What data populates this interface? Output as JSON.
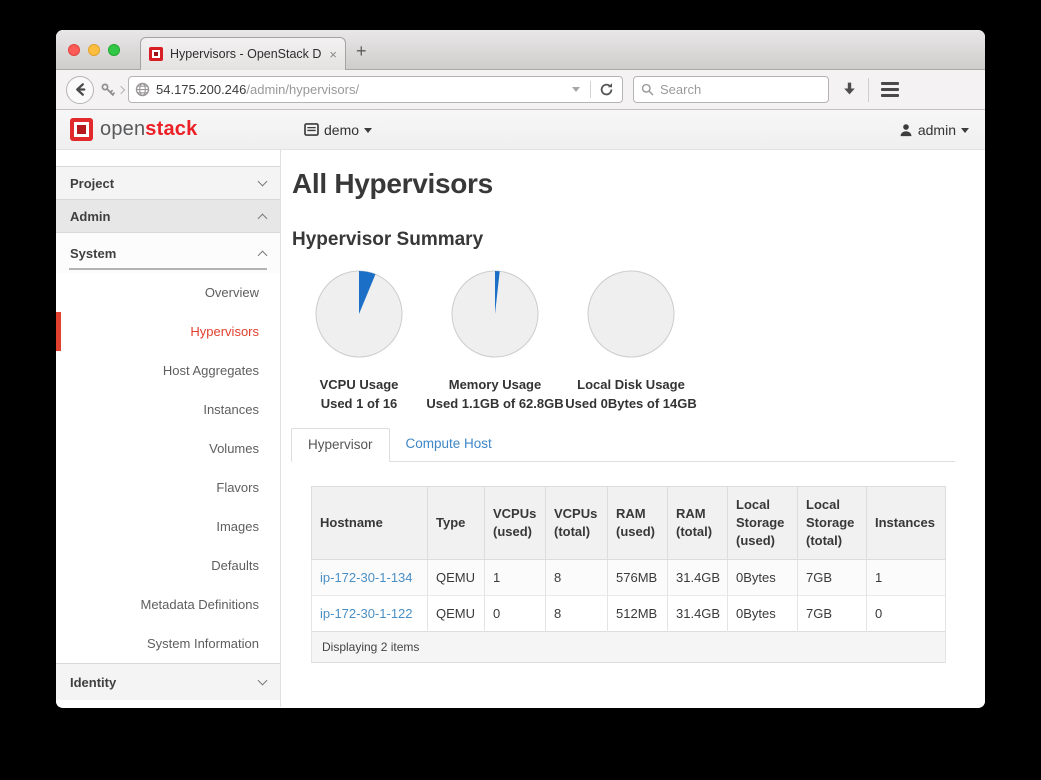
{
  "colors": {
    "accent": "#e0402e",
    "link": "#4a8fc4",
    "pie_used": "#1c6fc7",
    "pie_free": "#efefef",
    "logo_red": "#ed1f26"
  },
  "browser": {
    "tab_title": "Hypervisors - OpenStack D...",
    "close_tab": "×",
    "new_tab": "+",
    "url_host": "54.175.200.246",
    "url_path": "/admin/hypervisors/",
    "search_placeholder": "Search"
  },
  "header": {
    "brand_open": "open",
    "brand_stack": "stack",
    "project": "demo",
    "user": "admin"
  },
  "sidebar": {
    "project_label": "Project",
    "admin_label": "Admin",
    "system_label": "System",
    "identity_label": "Identity",
    "system_items": [
      {
        "label": "Overview",
        "active": false
      },
      {
        "label": "Hypervisors",
        "active": true
      },
      {
        "label": "Host Aggregates",
        "active": false
      },
      {
        "label": "Instances",
        "active": false
      },
      {
        "label": "Volumes",
        "active": false
      },
      {
        "label": "Flavors",
        "active": false
      },
      {
        "label": "Images",
        "active": false
      },
      {
        "label": "Defaults",
        "active": false
      },
      {
        "label": "Metadata Definitions",
        "active": false
      },
      {
        "label": "System Information",
        "active": false
      }
    ]
  },
  "main": {
    "page_title": "All Hypervisors",
    "summary_title": "Hypervisor Summary",
    "tabs": [
      {
        "label": "Hypervisor",
        "active": true
      },
      {
        "label": "Compute Host",
        "active": false
      }
    ]
  },
  "chart_data": [
    {
      "type": "pie",
      "title": "VCPU Usage",
      "subtitle": "Used 1 of 16",
      "used": 1,
      "total": 16
    },
    {
      "type": "pie",
      "title": "Memory Usage",
      "subtitle": "Used 1.1GB of 62.8GB",
      "used": 1.1,
      "total": 62.8
    },
    {
      "type": "pie",
      "title": "Local Disk Usage",
      "subtitle": "Used 0Bytes of 14GB",
      "used": 0,
      "total": 14
    }
  ],
  "table": {
    "headers": [
      "Hostname",
      "Type",
      "VCPUs (used)",
      "VCPUs (total)",
      "RAM (used)",
      "RAM (total)",
      "Local Storage (used)",
      "Local Storage (total)",
      "Instances"
    ],
    "rows": [
      [
        "ip-172-30-1-134",
        "QEMU",
        "1",
        "8",
        "576MB",
        "31.4GB",
        "0Bytes",
        "7GB",
        "1"
      ],
      [
        "ip-172-30-1-122",
        "QEMU",
        "0",
        "8",
        "512MB",
        "31.4GB",
        "0Bytes",
        "7GB",
        "0"
      ]
    ],
    "footer": "Displaying 2 items"
  }
}
